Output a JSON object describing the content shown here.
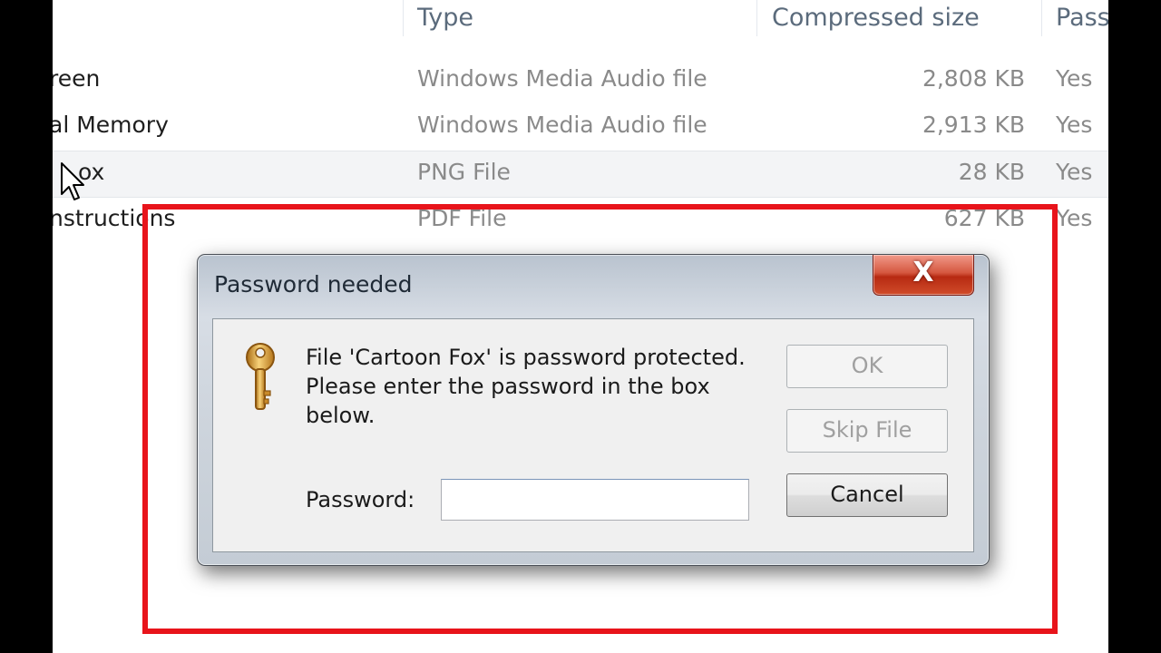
{
  "file_list": {
    "columns": {
      "type": "Type",
      "compressed_size": "Compressed size",
      "password": "Pass"
    },
    "rows": [
      {
        "name": "reen",
        "type": "Windows Media Audio file",
        "size": "2,808 KB",
        "password": "Yes"
      },
      {
        "name": "al Memory",
        "type": "Windows Media Audio file",
        "size": "2,913 KB",
        "password": "Yes"
      },
      {
        "name": "ox",
        "type": "PNG File",
        "size": "28 KB",
        "password": "Yes"
      },
      {
        "name": "nstructions",
        "type": "PDF File",
        "size": "627 KB",
        "password": "Yes"
      }
    ]
  },
  "dialog": {
    "title": "Password needed",
    "close_label": "X",
    "message_line1": "File 'Cartoon Fox' is password protected.",
    "message_line2": "Please enter the password in the box",
    "message_line3": "below.",
    "password_label": "Password:",
    "password_value": "",
    "ok_label": "OK",
    "skip_label": "Skip File",
    "cancel_label": "Cancel"
  },
  "colors": {
    "highlight": "#e8141b",
    "close_button": "#c8432a"
  },
  "icons": [
    "key-icon",
    "close-icon",
    "mouse-cursor-icon"
  ]
}
